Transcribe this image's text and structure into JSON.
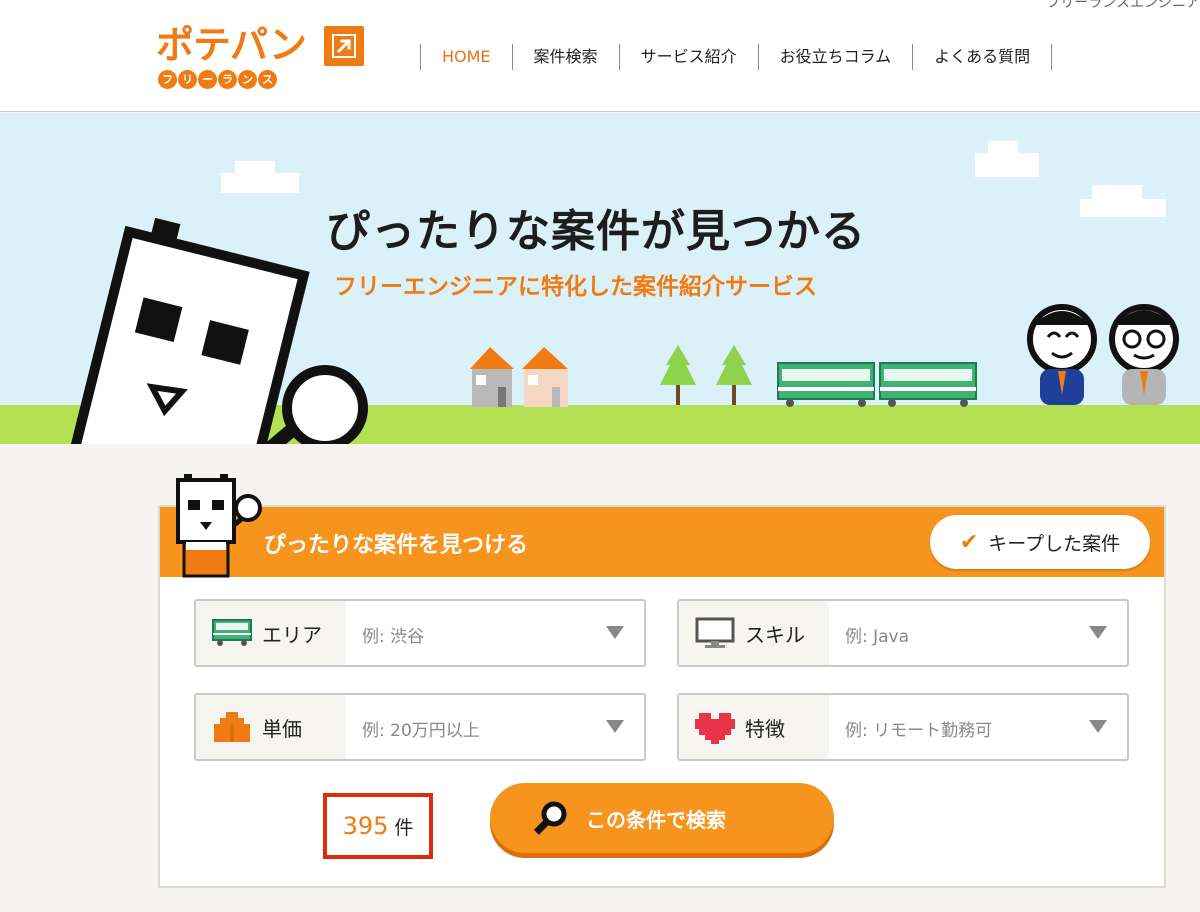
{
  "header": {
    "top_cut_text": "フリーランスエンジニア",
    "logo_main": "ポテパン",
    "logo_sub": [
      "フ",
      "リ",
      "ー",
      "ラ",
      "ン",
      "ス"
    ],
    "nav": [
      {
        "label": "HOME",
        "active": true
      },
      {
        "label": "案件検索",
        "active": false
      },
      {
        "label": "サービス紹介",
        "active": false
      },
      {
        "label": "お役立ちコラム",
        "active": false
      },
      {
        "label": "よくある質問",
        "active": false
      }
    ]
  },
  "hero": {
    "title": "ぴったりな案件が見つかる",
    "subtitle": "フリーエンジニアに特化した案件紹介サービス"
  },
  "search": {
    "title": "ぴったりな案件を見つける",
    "keep_label": "キープした案件",
    "fields": {
      "area": {
        "label": "エリア",
        "placeholder": "例: 渋谷",
        "icon": "train-icon"
      },
      "skill": {
        "label": "スキル",
        "placeholder": "例: Java",
        "icon": "monitor-icon"
      },
      "price": {
        "label": "単価",
        "placeholder": "例: 20万円以上",
        "icon": "money-bag-icon"
      },
      "feature": {
        "label": "特徴",
        "placeholder": "例: リモート勤務可",
        "icon": "heart-icon"
      }
    },
    "count": "395",
    "count_unit": "件",
    "button_label": "この条件で検索"
  },
  "colors": {
    "brand_orange": "#f07b12",
    "panel_orange": "#f7941d",
    "highlight_red": "#e02a0c",
    "sky": "#dbf1fa",
    "grass": "#b4e053"
  }
}
